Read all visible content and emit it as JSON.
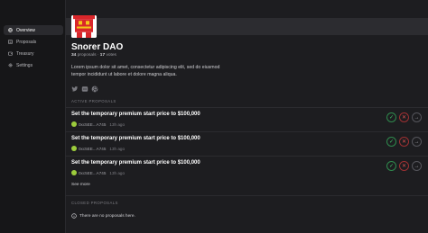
{
  "sidebar": {
    "items": [
      {
        "label": "Overview",
        "icon": "globe-icon",
        "active": true
      },
      {
        "label": "Proposals",
        "icon": "list-icon",
        "active": false
      },
      {
        "label": "Treasury",
        "icon": "wallet-icon",
        "active": false
      },
      {
        "label": "Settings",
        "icon": "gear-icon",
        "active": false
      }
    ]
  },
  "dao": {
    "name": "Snorer DAO",
    "proposals_count": "34",
    "proposals_label": "proposals",
    "separator": "·",
    "votes_count": "17",
    "votes_label": "votes",
    "description": "Lorem ipsum dolor sit amet, consectetur adipiscing elit, sed do eiusmod tempor incididunt ut labore et dolore magna aliqua.",
    "socials": [
      "twitter-icon",
      "discord-icon",
      "github-icon"
    ]
  },
  "active": {
    "label": "ACTIVE PROPOSALS",
    "items": [
      {
        "title": "Set the temporary premium start price to $100,000",
        "author": "0xc5EE...A745",
        "time": "13h ago"
      },
      {
        "title": "Set the temporary premium start price to $100,000",
        "author": "0xc5EE...A745",
        "time": "13h ago"
      },
      {
        "title": "Set the temporary premium start price to $100,000",
        "author": "0xc5EE...A745",
        "time": "13h ago"
      }
    ],
    "see_more": "See more"
  },
  "closed": {
    "label": "CLOSED PROPOSALS",
    "empty_text": "There are no proposals here."
  },
  "colors": {
    "for": "#3fc36a",
    "against": "#e05050",
    "abstain": "#a0a0a6",
    "avatar_red": "#d9262a",
    "avatar_yellow": "#f3c61b"
  },
  "action_glyphs": {
    "for": "✓",
    "against": "✕",
    "abstain": "→"
  }
}
